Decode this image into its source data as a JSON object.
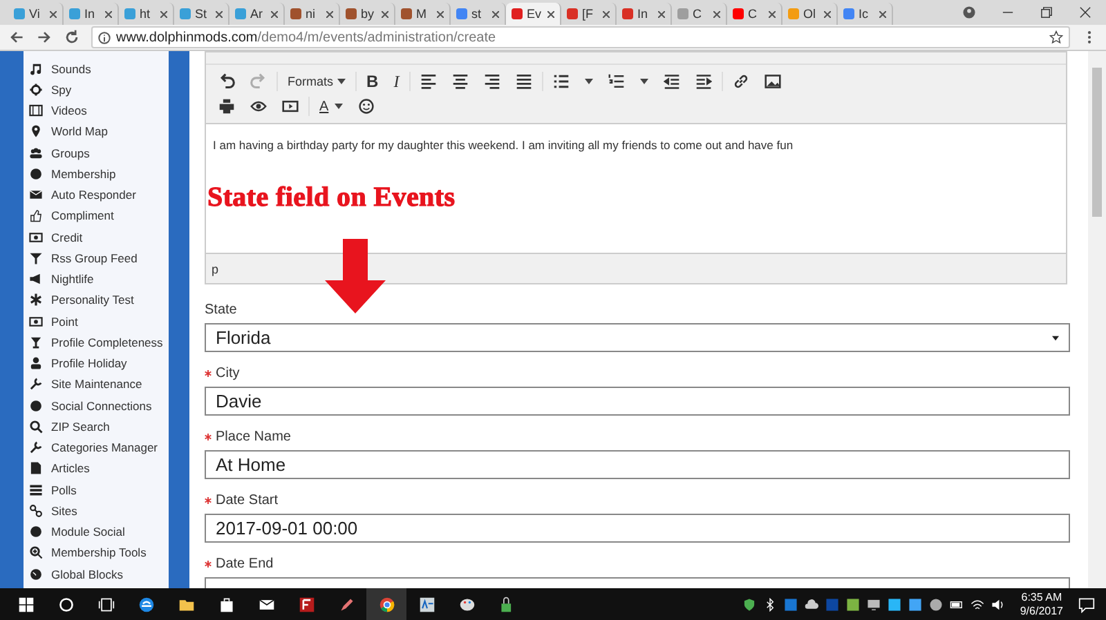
{
  "browser": {
    "tabs": [
      {
        "label": "Vi",
        "selected": false,
        "color": "#3aa0d8"
      },
      {
        "label": "In",
        "selected": false,
        "color": "#3aa0d8"
      },
      {
        "label": "ht",
        "selected": false,
        "color": "#3aa0d8"
      },
      {
        "label": "St",
        "selected": false,
        "color": "#3aa0d8"
      },
      {
        "label": "Ar",
        "selected": false,
        "color": "#3aa0d8"
      },
      {
        "label": "ni",
        "selected": false,
        "color": "#a0522d"
      },
      {
        "label": "by",
        "selected": false,
        "color": "#a0522d"
      },
      {
        "label": "M",
        "selected": false,
        "color": "#a0522d"
      },
      {
        "label": "st",
        "selected": false,
        "color": "#4285f4"
      },
      {
        "label": "Ev",
        "selected": true,
        "color": "#e02020"
      },
      {
        "label": "[F",
        "selected": false,
        "color": "#d93025"
      },
      {
        "label": "In",
        "selected": false,
        "color": "#d93025"
      },
      {
        "label": "C",
        "selected": false,
        "color": "#9e9e9e"
      },
      {
        "label": "C",
        "selected": false,
        "color": "#ff0000"
      },
      {
        "label": "Ol",
        "selected": false,
        "color": "#f39c12"
      },
      {
        "label": "Ic",
        "selected": false,
        "color": "#4285f4"
      }
    ],
    "url": {
      "domain": "www.dolphinmods.com",
      "path": "/demo4/m/events/administration/create"
    }
  },
  "sidebar": {
    "items": [
      {
        "label": "Sounds"
      },
      {
        "label": "Spy"
      },
      {
        "label": "Videos"
      },
      {
        "label": "World Map"
      },
      {
        "label": "Groups"
      },
      {
        "label": "Membership"
      },
      {
        "label": "Auto Responder"
      },
      {
        "label": "Compliment"
      },
      {
        "label": "Credit"
      },
      {
        "label": "Rss Group Feed"
      },
      {
        "label": "Nightlife"
      },
      {
        "label": "Personality Test"
      },
      {
        "label": "Point"
      },
      {
        "label": "Profile Completeness"
      },
      {
        "label": "Profile Holiday"
      },
      {
        "label": "Site Maintenance"
      },
      {
        "label": "Social Connections"
      },
      {
        "label": "ZIP Search"
      },
      {
        "label": "Categories Manager"
      },
      {
        "label": "Articles"
      },
      {
        "label": "Polls"
      },
      {
        "label": "Sites"
      },
      {
        "label": "Module Social"
      },
      {
        "label": "Membership Tools"
      },
      {
        "label": "Global Blocks"
      }
    ]
  },
  "editor": {
    "toolbar": {
      "formats": "Formats",
      "bold": "B",
      "italic": "I",
      "text_color": "A"
    },
    "content": "I am having a birthday party for my daughter this weekend. I am inviting all my friends to come out and have fun",
    "path": "p"
  },
  "annotation": {
    "text": "State field on Events"
  },
  "form": {
    "fields": [
      {
        "label": "State",
        "required": false,
        "kind": "select",
        "value": "Florida"
      },
      {
        "label": "City",
        "required": true,
        "kind": "input",
        "value": "Davie"
      },
      {
        "label": "Place Name",
        "required": true,
        "kind": "input",
        "value": "At Home"
      },
      {
        "label": "Date Start",
        "required": true,
        "kind": "input",
        "value": "2017-09-01 00:00"
      },
      {
        "label": "Date End",
        "required": true,
        "kind": "input"
      }
    ]
  },
  "taskbar": {
    "time": "6:35 AM",
    "date": "9/6/2017"
  }
}
